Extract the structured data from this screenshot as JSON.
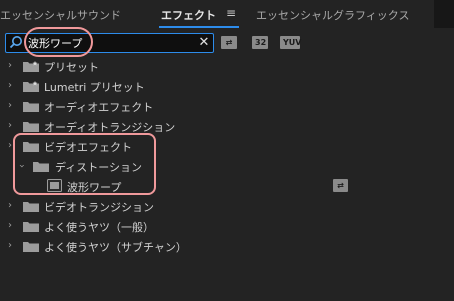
{
  "tabs": {
    "essential_sound": "エッセンシャルサウンド",
    "effects": "エフェクト",
    "menu_icon": "≡",
    "essential_graphics": "エッセンシャルグラフィックス"
  },
  "search": {
    "value": "波形ワープ",
    "clear_icon": "✕"
  },
  "filter_badges": {
    "accelerated": "⇄",
    "bit32": "32",
    "yuv": "YUV"
  },
  "tree": {
    "presets": "プリセット",
    "lumetri_presets": "Lumetri プリセット",
    "audio_effects": "オーディオエフェクト",
    "audio_transitions": "オーディオトランジション",
    "video_effects": "ビデオエフェクト",
    "distort": "ディストーション",
    "wave_warp": "波形ワープ",
    "video_transitions": "ビデオトランジション",
    "favorites_general": "よく使うヤツ（一般）",
    "favorites_subchannel": "よく使うヤツ（サブチャン）"
  },
  "colors": {
    "accent": "#2d8ceb",
    "highlight": "#f0999b",
    "background": "#232323"
  }
}
